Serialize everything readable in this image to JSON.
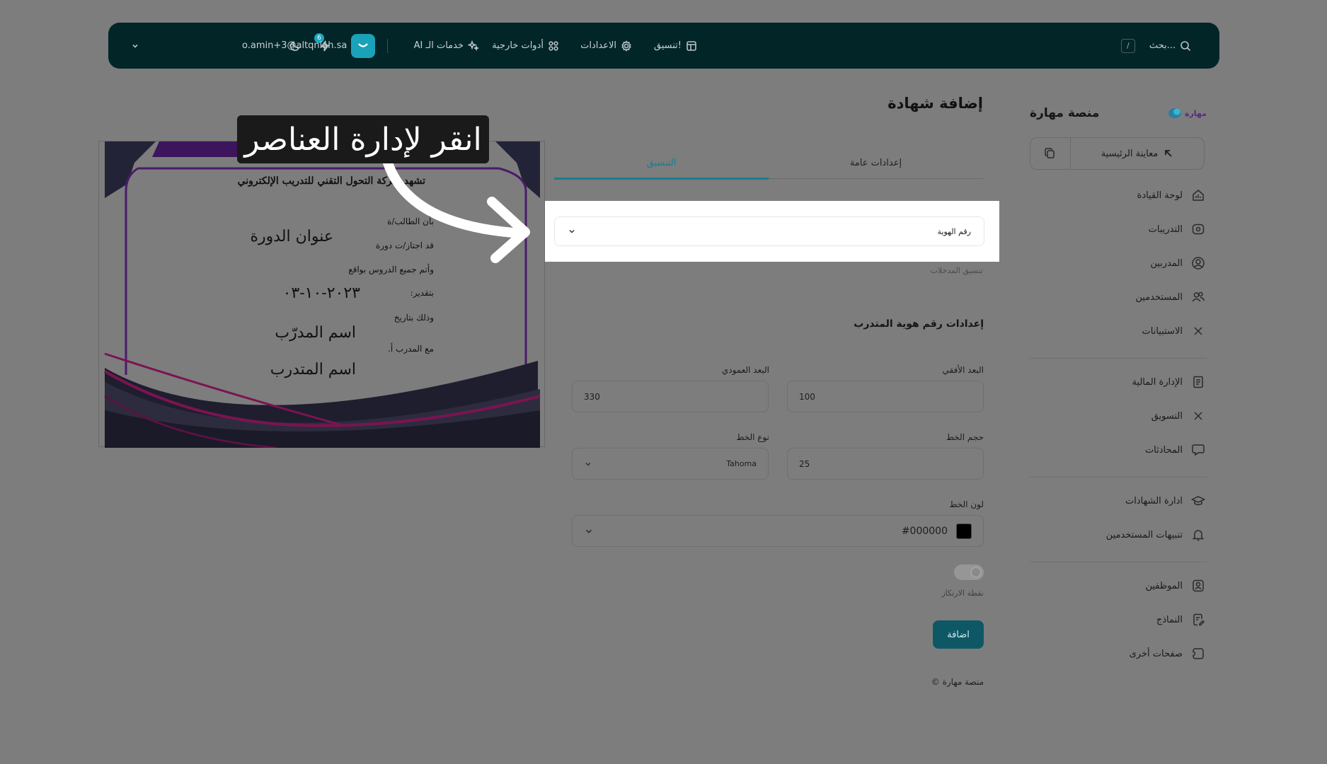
{
  "topbar": {
    "search_placeholder": "بحث...",
    "search_shortcut": "/",
    "nav": [
      "تنسيق!",
      "الاعدادات",
      "أدوات خارجية",
      "خدمات الـ AI"
    ],
    "notification_count": "6",
    "user_email": "o.amin+3@altqniah.sa"
  },
  "sidebar": {
    "title": "منصة مهارة",
    "logo_text": "مهارة",
    "home_preview": "معاينة الرئيسية",
    "items": [
      {
        "label": "لوحة القيادة",
        "icon": "dashboard-icon"
      },
      {
        "label": "التدريبات",
        "icon": "trainings-icon"
      },
      {
        "label": "المدربين",
        "icon": "trainers-icon"
      },
      {
        "label": "المستخدمين",
        "icon": "users-icon"
      },
      {
        "label": "الاستبيانات",
        "icon": "surveys-icon"
      },
      {
        "label": "الإدارة المالية",
        "icon": "finance-icon"
      },
      {
        "label": "التسويق",
        "icon": "marketing-icon"
      },
      {
        "label": "المحادثات",
        "icon": "chat-icon"
      },
      {
        "label": "ادارة الشهادات",
        "icon": "graduation-cap-icon"
      },
      {
        "label": "تنبيهات المستخدمين",
        "icon": "bell-icon"
      },
      {
        "label": "الموظفين",
        "icon": "employees-icon"
      },
      {
        "label": "النماذج",
        "icon": "forms-icon"
      },
      {
        "label": "صفحات أخرى",
        "icon": "pages-icon"
      }
    ]
  },
  "page": {
    "title": "إضافة شهادة",
    "tabs": [
      "إعدادات عامة",
      "التنسيق"
    ],
    "active_tab": "التنسيق",
    "element_select": "رقم الهوية",
    "hint": "تنسيق المدخلات",
    "section_title": "إعدادات رقم هوية المتدرب",
    "fields": {
      "horizontal_label": "البعد الأفقي",
      "horizontal_value": "100",
      "vertical_label": "البعد العمودي",
      "vertical_value": "330",
      "font_size_label": "حجم الخط",
      "font_size_value": "25",
      "font_type_label": "نوع الخط",
      "font_type_value": "Tahoma",
      "font_color_label": "لون الخط",
      "font_color_value": "#000000"
    },
    "toggle_label": "نقطة الارتكاز",
    "add_button": "اضافة",
    "footer": "© منصة مهارة"
  },
  "certificate": {
    "heading": "تشهد شركة التحول التقني للتدريب الإلكتروني",
    "line_student": "بأن الطالب/ة",
    "line_passed": "قد اجتاز/ت دورة",
    "course_title": "عنوان الدورة",
    "line_completed": "وأتم جميع الدروس بواقع",
    "line_grade": "بتقدير:",
    "date": "٢٠٢٣-١٠-٠٣",
    "line_date": "وذلك بتاريخ",
    "trainer_name": "اسم المدرّب",
    "line_trainer": "مع المدرب أ.",
    "trainee_name": "اسم المتدرب"
  },
  "tooltip": "انقر لإدارة العناصر",
  "colors": {
    "topbar": "#022528",
    "accent": "#1aa3b8",
    "tab_active": "#1a7d8f",
    "button": "#0e5866",
    "certificate_purple": "#5a1a78",
    "certificate_magenta": "#8e1460"
  }
}
